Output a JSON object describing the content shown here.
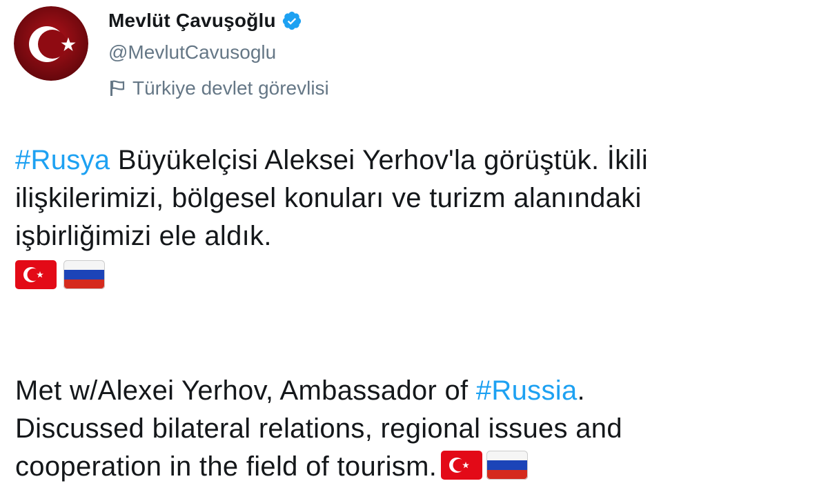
{
  "author": {
    "display_name": "Mevlüt Çavuşoğlu",
    "handle": "@MevlutCavusoglu",
    "verified": true,
    "label": "Türkiye devlet görevlisi"
  },
  "tweet": {
    "tr_hashtag": "#Rusya",
    "tr_line1_rest": " Büyükelçisi Aleksei Yerhov'la görüştük. İkili",
    "tr_line2": "ilişkilerimizi, bölgesel konuları ve turizm alanındaki",
    "tr_line3": "işbirliğimizi ele aldık.",
    "en_line1_prefix": "Met w/Alexei Yerhov, Ambassador of ",
    "en_hashtag": "#Russia",
    "en_line1_suffix": ".",
    "en_line2": "Discussed bilateral relations, regional issues and",
    "en_line3": "cooperation in the field of tourism."
  },
  "emoji": [
    "turkey-flag",
    "russia-flag"
  ],
  "colors": {
    "hashtag": "#1da1f2",
    "secondary_text": "#657786",
    "verified": "#1da1f2",
    "turkey_red": "#e30a17",
    "avatar_red": "#8b0a10"
  }
}
